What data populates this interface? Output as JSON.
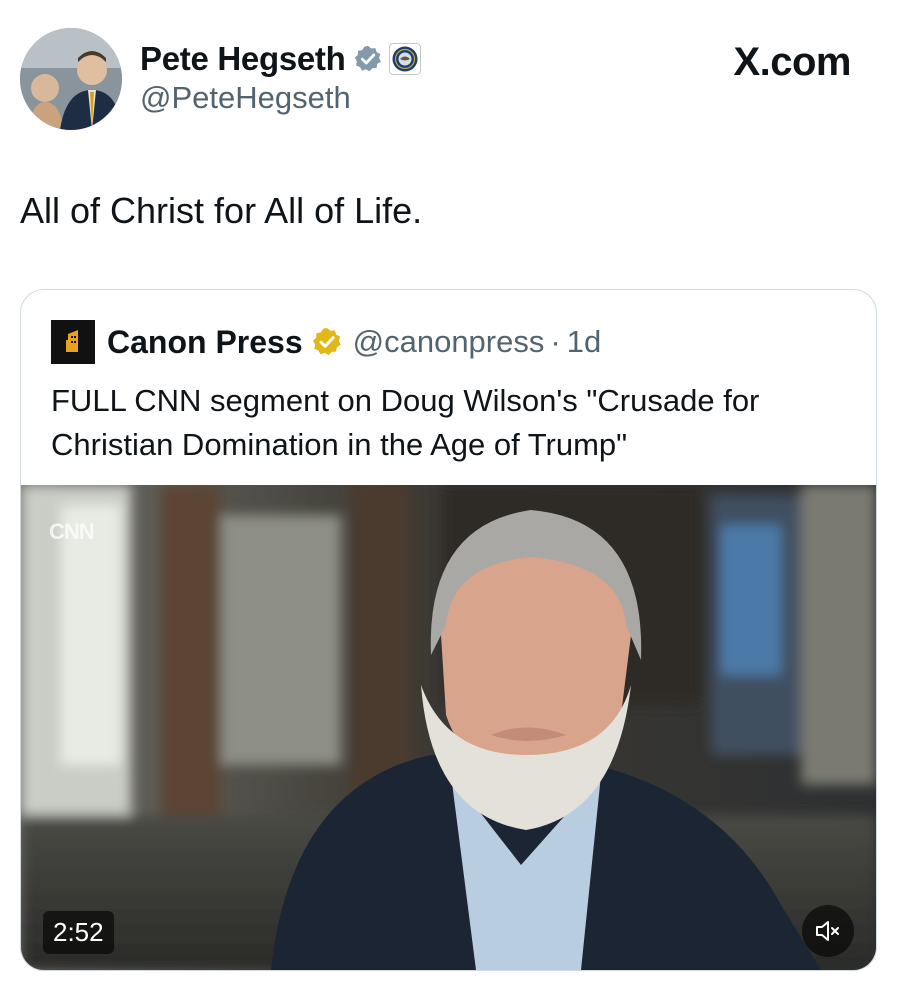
{
  "author": {
    "display_name": "Pete Hegseth",
    "handle": "@PeteHegseth",
    "avatar_icon": "profile-photo-icon",
    "verified_icon": "verified-badge-icon",
    "affiliation_icon": "department-seal-icon"
  },
  "watermark": "X.com",
  "tweet_text": "All of Christ for All of Life.",
  "quoted": {
    "logo_icon": "canon-press-logo-icon",
    "display_name": "Canon Press",
    "verified_icon": "gold-verified-badge-icon",
    "handle": "@canonpress",
    "separator": "·",
    "time": "1d",
    "text": "FULL CNN segment on Doug Wilson's \"Crusade for Christian Domination in the Age of Trump\"",
    "video": {
      "channel_logo": "CNN",
      "duration": "2:52",
      "mute_icon": "muted-speaker-icon"
    }
  },
  "colors": {
    "text": "#0f1419",
    "secondary": "#536471",
    "verified_blue": "#829aab",
    "gold": "#e2b719",
    "border": "#cfd9de"
  }
}
